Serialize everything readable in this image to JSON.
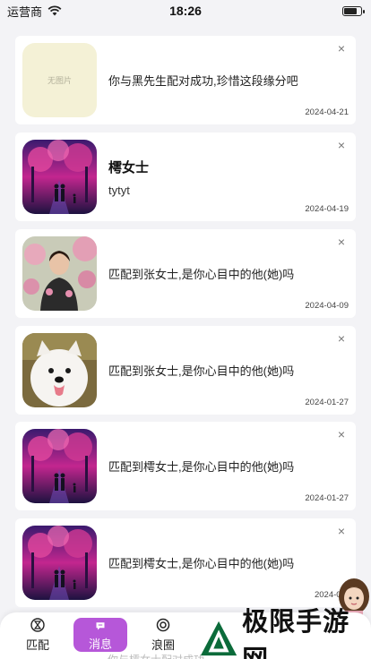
{
  "status_bar": {
    "carrier": "运营商",
    "time": "18:26",
    "battery_level": 0.85
  },
  "messages": [
    {
      "image": "placeholder",
      "image_placeholder": "无图片",
      "text": "你与黑先生配对成功,珍惜这段缘分吧",
      "date": "2024-04-21"
    },
    {
      "image": "couple-illustration",
      "title": "樗女士",
      "subtitle": "tytyt",
      "date": "2024-04-19"
    },
    {
      "image": "woman-photo",
      "text": "匹配到张女士,是你心目中的他(她)吗",
      "date": "2024-04-09"
    },
    {
      "image": "dog-photo",
      "text": "匹配到张女士,是你心目中的他(她)吗",
      "date": "2024-01-27"
    },
    {
      "image": "couple-illustration",
      "text": "匹配到樗女士,是你心目中的他(她)吗",
      "date": "2024-01-27"
    },
    {
      "image": "couple-illustration",
      "text": "匹配到樗女士,是你心目中的他(她)吗",
      "date": "2024-01-"
    }
  ],
  "close_glyph": "×",
  "tabbar": {
    "tabs": [
      {
        "label": "匹配",
        "icon": "hourglass-icon",
        "active": false
      },
      {
        "label": "消息",
        "icon": "chat-icon",
        "active": true
      },
      {
        "label": "浪圈",
        "icon": "circle-icon",
        "active": false
      }
    ],
    "active_color": "#b657d9",
    "peek_text": "你与樗女士配对成功"
  },
  "watermark": {
    "text": "极限手游网"
  },
  "colors": {
    "background": "#f3f3f6",
    "placeholder_bg": "#f4f1d6"
  }
}
